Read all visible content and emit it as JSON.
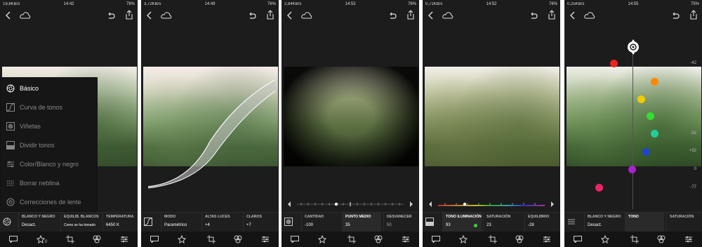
{
  "panels": [
    {
      "status": {
        "left": "19,6KB/s",
        "time": "14:42",
        "battery": "78%"
      },
      "menu": [
        {
          "label": "Básico",
          "icon": "aperture-icon"
        },
        {
          "label": "Curva de tonos",
          "icon": "curve-icon"
        },
        {
          "label": "Viñetas",
          "icon": "vignette-icon"
        },
        {
          "label": "Dividir tonos",
          "icon": "split-tone-icon"
        },
        {
          "label": "Color/Blanco y negro",
          "icon": "color-bw-icon"
        },
        {
          "label": "Borrar neblina",
          "icon": "dehaze-icon"
        },
        {
          "label": "Correcciones de lente",
          "icon": "lens-icon"
        }
      ],
      "cells": [
        {
          "k": "BLANCO Y NEGRO",
          "v": "Desact."
        },
        {
          "k": "EQUILIB. BLANCOS",
          "v": "Como se ha tomado"
        },
        {
          "k": "TEMPERATURA",
          "v": "6450 K"
        }
      ]
    },
    {
      "status": {
        "left": "3,72KB/s",
        "time": "14:49",
        "battery": "76%"
      },
      "cells": [
        {
          "k": "MODO",
          "v": "Paramétrico"
        },
        {
          "k": "ALTAS LUCES",
          "v": "+4"
        },
        {
          "k": "CLAROS",
          "v": "+7"
        }
      ]
    },
    {
      "status": {
        "left": "2,84KB/s",
        "time": "14:53",
        "battery": "76%"
      },
      "cells": [
        {
          "k": "CANTIDAD",
          "v": "-100"
        },
        {
          "k": "PUNTO MEDIO",
          "v": "35"
        },
        {
          "k": "DESVANECER",
          "v": "50"
        }
      ]
    },
    {
      "status": {
        "left": "0,71KB/s",
        "time": "14:52",
        "battery": "76%"
      },
      "cells": [
        {
          "k": "TONO ILUMINACIÓN",
          "v": "93"
        },
        {
          "k": "SATURACIÓN",
          "v": "23"
        },
        {
          "k": "EQUILIBRIO",
          "v": "-28"
        }
      ]
    },
    {
      "status": {
        "left": "0,25KB/s",
        "time": "14:55",
        "battery": "75%"
      },
      "cells": [
        {
          "k": "BLANCO Y NEGRO",
          "v": "Desact."
        },
        {
          "k": "TONO",
          "v": ""
        },
        {
          "k": "SATURACIÓN",
          "v": ""
        }
      ],
      "scale": [
        "-42",
        "-52",
        "+32",
        "0",
        "-77"
      ]
    }
  ],
  "colors": {
    "accent": "#ffffff",
    "bg": "#1c1c1c"
  }
}
